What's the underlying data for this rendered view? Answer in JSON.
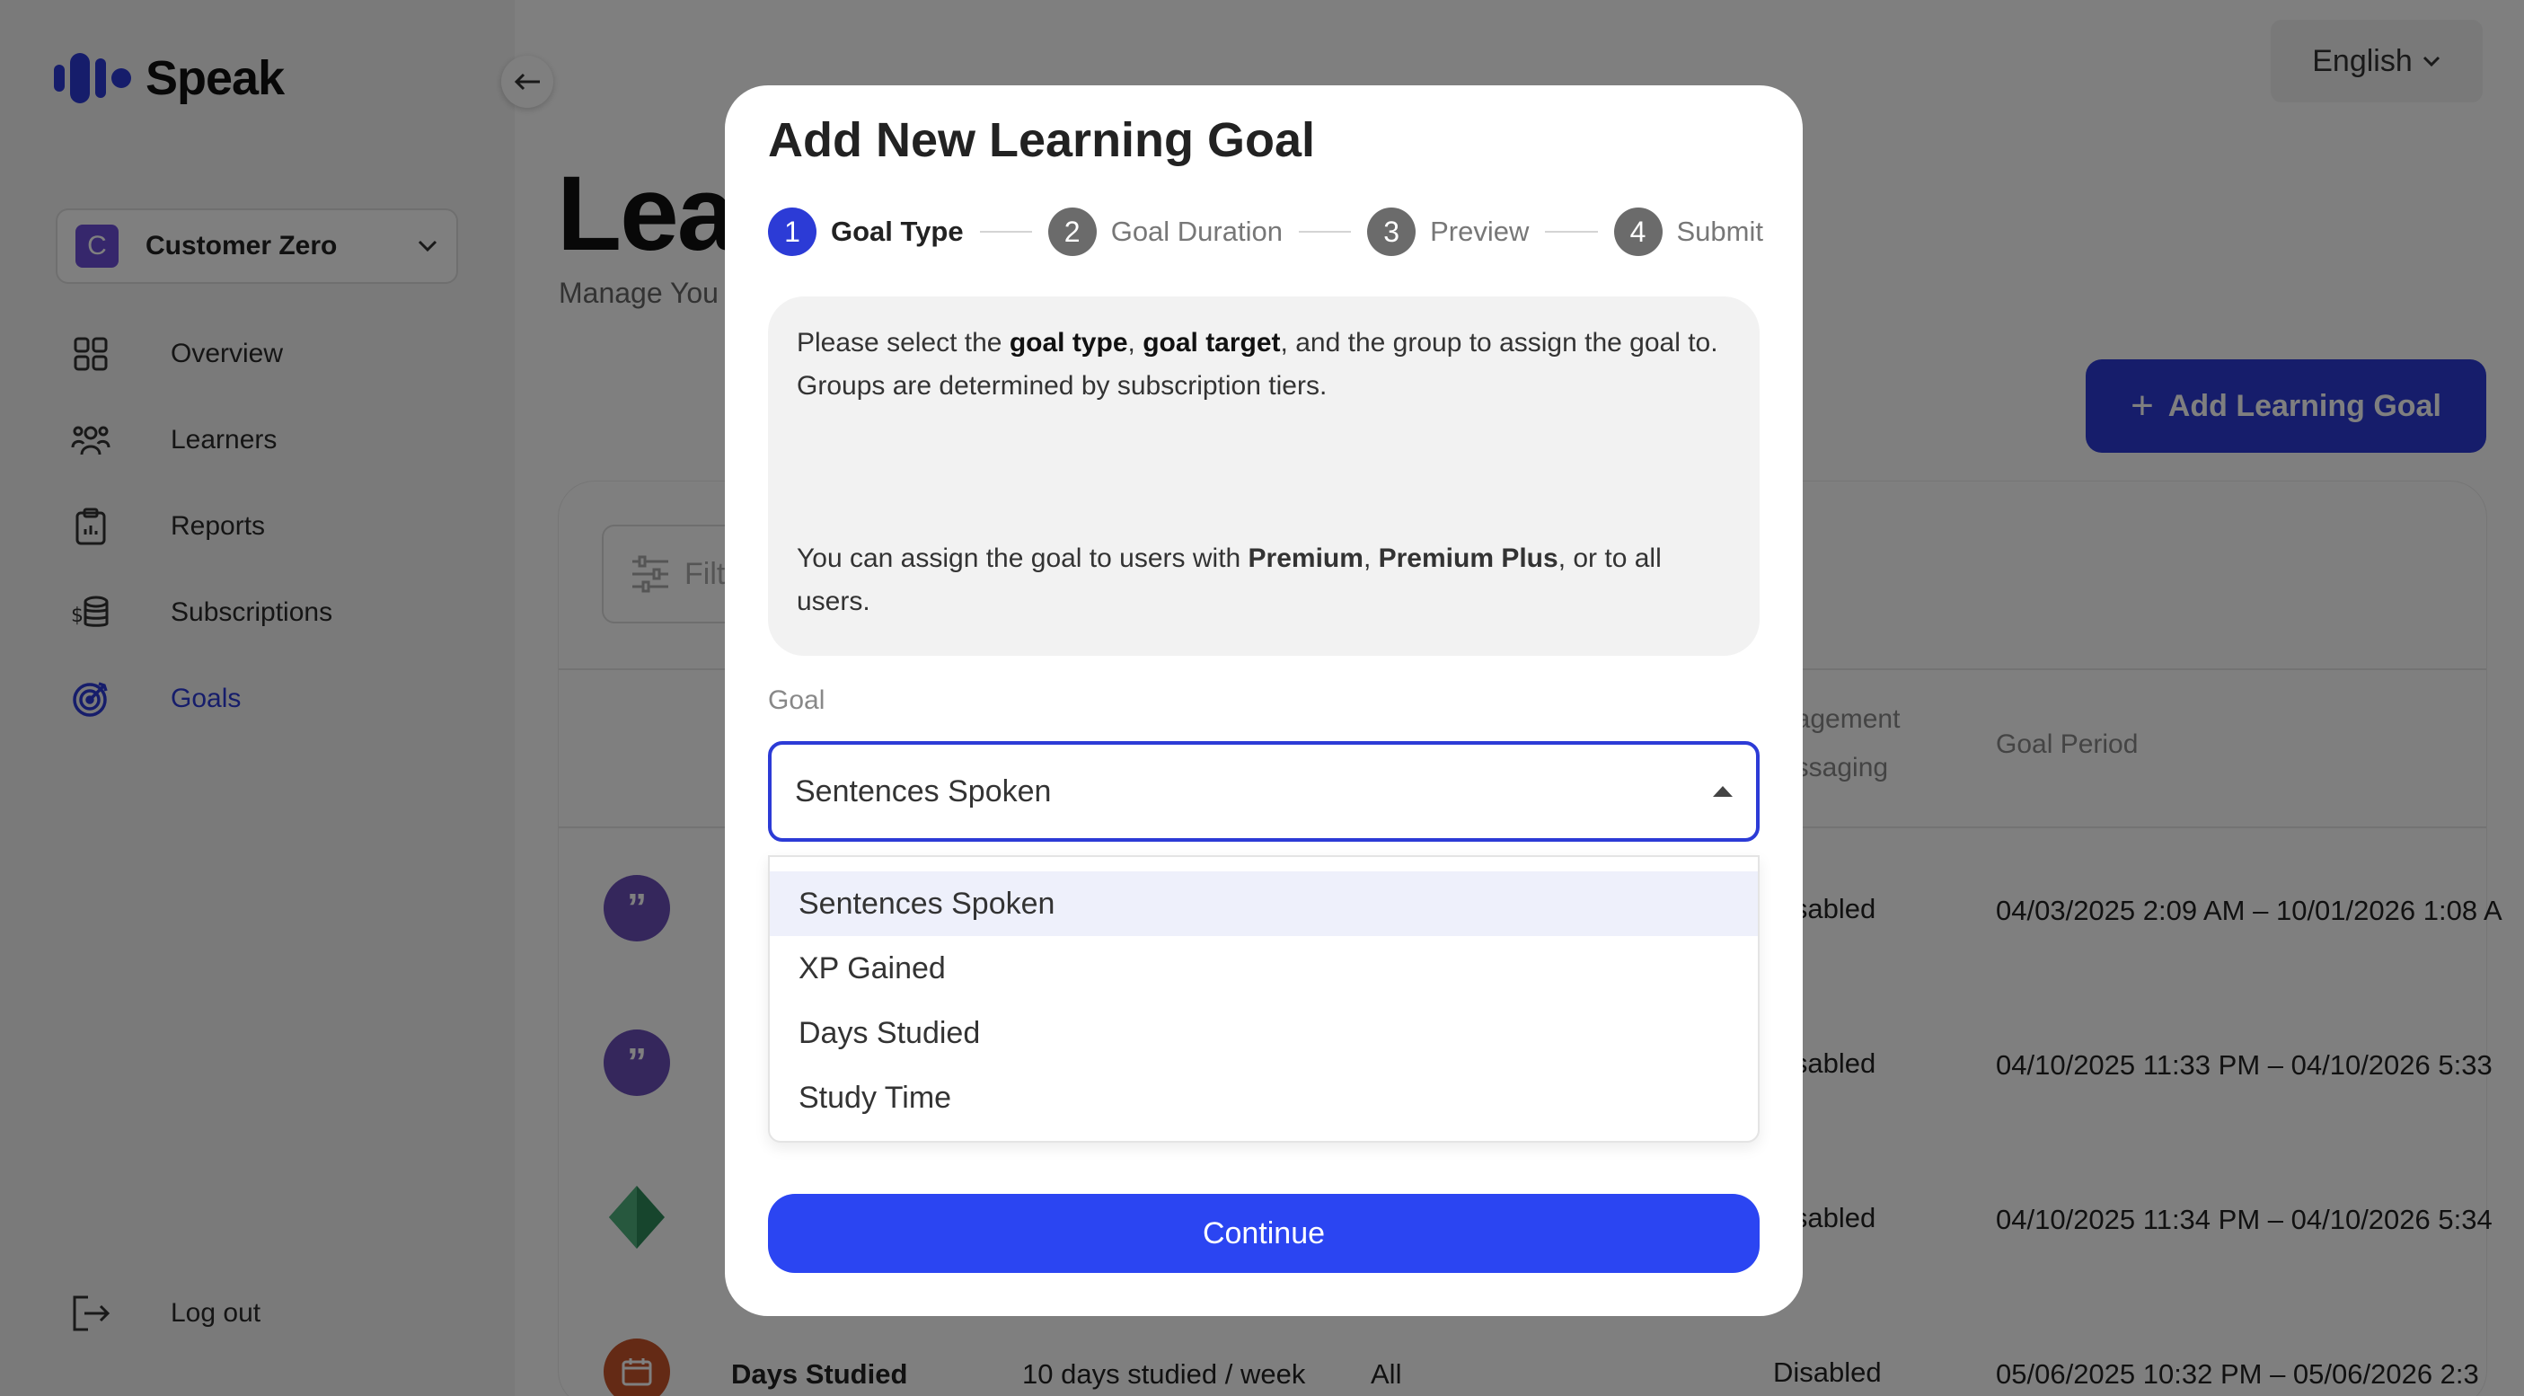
{
  "app": {
    "name": "Speak",
    "language": "English"
  },
  "sidebar": {
    "org": {
      "initial": "C",
      "name": "Customer Zero"
    },
    "items": [
      {
        "label": "Overview",
        "icon": "grid-icon"
      },
      {
        "label": "Learners",
        "icon": "users-icon"
      },
      {
        "label": "Reports",
        "icon": "clipboard-icon"
      },
      {
        "label": "Subscriptions",
        "icon": "coins-icon"
      },
      {
        "label": "Goals",
        "icon": "target-icon",
        "active": true
      }
    ],
    "logout_label": "Log out"
  },
  "page": {
    "title": "Lea",
    "subtitle": "Manage You",
    "add_button_label": "Add Learning Goal",
    "filter_placeholder": "Filt",
    "headers": {
      "engagement_line1": "gagement",
      "engagement_line2": "essaging",
      "goal_period": "Goal Period"
    },
    "rows": [
      {
        "icon": "quote-icon",
        "color": "#6a4fb8",
        "engagement": "isabled",
        "period": "04/03/2025 2:09 AM – 10/01/2026 1:08 A"
      },
      {
        "icon": "quote-icon",
        "color": "#6a4fb8",
        "engagement": "isabled",
        "period": "04/10/2025 11:33 PM – 04/10/2026 5:33"
      },
      {
        "icon": "diamond-icon",
        "color": "#2e8a5a",
        "engagement": "isabled",
        "period": "04/10/2025 11:34 PM – 04/10/2026 5:34"
      },
      {
        "icon": "calendar-icon",
        "color": "#c8552a",
        "name": "Days Studied",
        "target": "10 days studied / week",
        "group": "All",
        "engagement": "Disabled",
        "period": "05/06/2025 10:32 PM – 05/06/2026 2:3"
      }
    ]
  },
  "modal": {
    "title": "Add New Learning Goal",
    "steps": [
      {
        "num": "1",
        "label": "Goal Type"
      },
      {
        "num": "2",
        "label": "Goal Duration"
      },
      {
        "num": "3",
        "label": "Preview"
      },
      {
        "num": "4",
        "label": "Submit"
      }
    ],
    "info": {
      "p1_a": "Please select the ",
      "p1_b": "goal type",
      "p1_c": ", ",
      "p1_d": "goal target",
      "p1_e": ", and the group to assign the goal to. Groups are determined by subscription tiers.",
      "p2_a": "You can assign the goal to users with ",
      "p2_b": "Premium",
      "p2_c": ", ",
      "p2_d": "Premium Plus",
      "p2_e": ", or to all users."
    },
    "goal_label": "Goal",
    "goal_value": "Sentences Spoken",
    "options": [
      "Sentences Spoken",
      "XP Gained",
      "Days Studied",
      "Study Time"
    ],
    "continue_label": "Continue"
  },
  "colors": {
    "accent": "#2c3bd6",
    "button": "#2b45f2"
  }
}
